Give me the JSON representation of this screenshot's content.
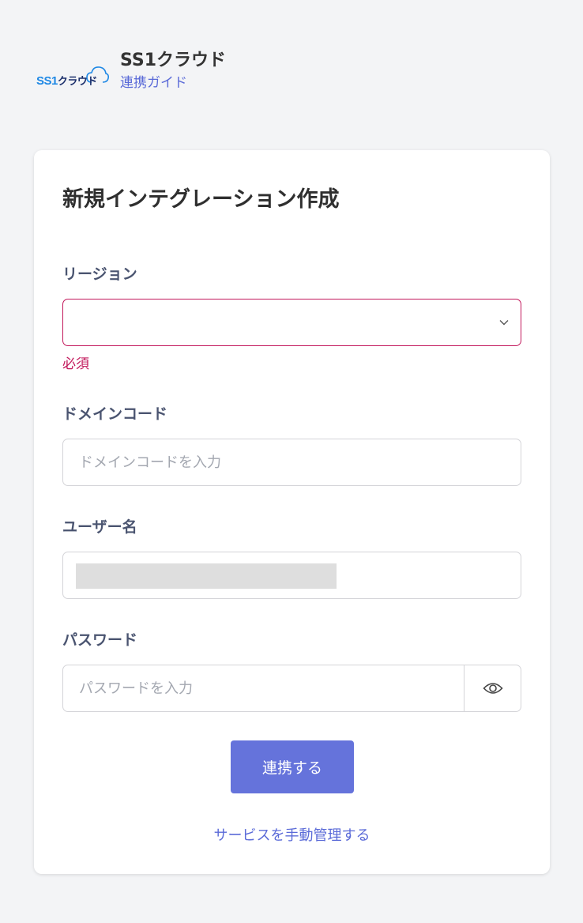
{
  "header": {
    "logo_text_latin": "SS1",
    "logo_text_kana": "クラウド",
    "app_name": "SS1クラウド",
    "guide_link": "連携ガイド"
  },
  "form": {
    "title": "新規インテグレーション作成",
    "region": {
      "label": "リージョン",
      "value": "",
      "error": "必須"
    },
    "domain": {
      "label": "ドメインコード",
      "placeholder": "ドメインコードを入力",
      "value": ""
    },
    "username": {
      "label": "ユーザー名"
    },
    "password": {
      "label": "パスワード",
      "placeholder": "パスワードを入力",
      "value": ""
    },
    "submit_label": "連携する",
    "manual_link": "サービスを手動管理する"
  },
  "colors": {
    "accent": "#6573db",
    "link": "#5b6bd8",
    "error": "#c2185b"
  },
  "icons": {
    "region_select": "chevron-down-icon",
    "password_toggle": "eye-icon",
    "logo_cloud": "cloud-icon"
  }
}
